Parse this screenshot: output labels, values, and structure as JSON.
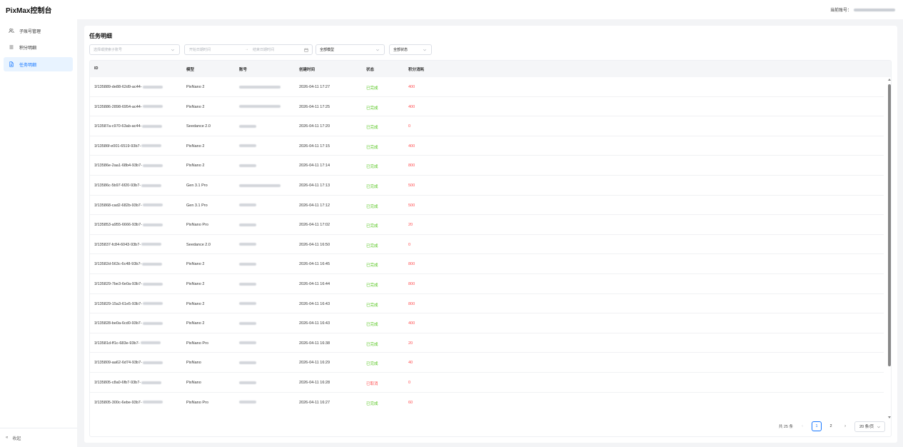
{
  "app": {
    "title": "PixMax控制台"
  },
  "header": {
    "account_label": "当前账号："
  },
  "sidebar": {
    "items": [
      {
        "label": "子账号管理",
        "icon": "users-icon"
      },
      {
        "label": "积分明细",
        "icon": "list-icon"
      },
      {
        "label": "任务明细",
        "icon": "document-icon",
        "active": true
      }
    ],
    "collapse_label": "收起"
  },
  "main": {
    "title": "任务明细",
    "filters": {
      "sub_account_placeholder": "选择或搜索子账号",
      "start_date_placeholder": "开始日期时间",
      "end_date_placeholder": "结束日期时间",
      "model_value": "全部模型",
      "status_value": "全部状态"
    },
    "table": {
      "columns": [
        "ID",
        "模型",
        "账号",
        "创建时间",
        "状态",
        "积分消耗"
      ],
      "rows": [
        {
          "id": "1f135889-de88-62d9-ac44-",
          "model": "PixNano 2",
          "time": "2026-04-11 17:27",
          "status": "已完成",
          "points": "400"
        },
        {
          "id": "1f135886-2898-6954-ac44-",
          "model": "PixNano 2",
          "time": "2026-04-11 17:25",
          "status": "已完成",
          "points": "400"
        },
        {
          "id": "1f13587a-c970-63ab-ac44-",
          "model": "Seedance 2.0",
          "time": "2026-04-11 17:20",
          "status": "已完成",
          "points": "0"
        },
        {
          "id": "1f13586f-e001-6519-93b7-",
          "model": "PixNano 2",
          "time": "2026-04-11 17:15",
          "status": "已完成",
          "points": "400"
        },
        {
          "id": "1f13586e-2aa1-68b4-93b7-",
          "model": "PixNano 2",
          "time": "2026-04-11 17:14",
          "status": "已完成",
          "points": "800"
        },
        {
          "id": "1f13586c-5b97-6f20-93b7-",
          "model": "Gen 3.1 Pro",
          "time": "2026-04-11 17:13",
          "status": "已完成",
          "points": "500"
        },
        {
          "id": "1f135868-cad2-682b-93b7-",
          "model": "Gen 3.1 Pro",
          "time": "2026-04-11 17:12",
          "status": "已完成",
          "points": "500"
        },
        {
          "id": "1f135853-a955-6666-93b7-",
          "model": "PixNano Pro",
          "time": "2026-04-11 17:02",
          "status": "已完成",
          "points": "20"
        },
        {
          "id": "1f135837-fc84-6043-93b7-",
          "model": "Seedance 2.0",
          "time": "2026-04-11 16:50",
          "status": "已完成",
          "points": "0"
        },
        {
          "id": "1f13582d-563c-6c48-93b7-",
          "model": "PixNano 2",
          "time": "2026-04-11 16:45",
          "status": "已完成",
          "points": "800"
        },
        {
          "id": "1f135829-7be3-6e0a-93b7-",
          "model": "PixNano 2",
          "time": "2026-04-11 16:44",
          "status": "已完成",
          "points": "800"
        },
        {
          "id": "1f135829-15a3-61e5-93b7-",
          "model": "PixNano 2",
          "time": "2026-04-11 16:43",
          "status": "已完成",
          "points": "800"
        },
        {
          "id": "1f135828-be0a-6cd0-93b7-",
          "model": "PixNano 2",
          "time": "2026-04-11 16:43",
          "status": "已完成",
          "points": "400"
        },
        {
          "id": "1f13581d-ff1c-683e-93b7-",
          "model": "PixNano Pro",
          "time": "2026-04-11 16:38",
          "status": "已完成",
          "points": "20"
        },
        {
          "id": "1f135809-aa62-6d74-93b7-",
          "model": "PixNano",
          "time": "2026-04-11 16:29",
          "status": "已完成",
          "points": "40"
        },
        {
          "id": "1f135805-c8a0-6fb7-93b7-",
          "model": "PixNano",
          "time": "2026-04-11 16:28",
          "status": "已取消",
          "points": "0"
        },
        {
          "id": "1f135805-300c-6ebe-93b7-",
          "model": "PixNano Pro",
          "time": "2026-04-11 16:27",
          "status": "已完成",
          "points": "60"
        }
      ]
    },
    "pagination": {
      "total": "共 25 条",
      "pages": [
        "1",
        "2"
      ],
      "current": "1",
      "page_size": "20 条/页"
    }
  },
  "colors": {
    "accent": "#1677ff",
    "done": "#52c41a",
    "cancelled": "#ff4d4f",
    "points": "#ff4d4f"
  }
}
